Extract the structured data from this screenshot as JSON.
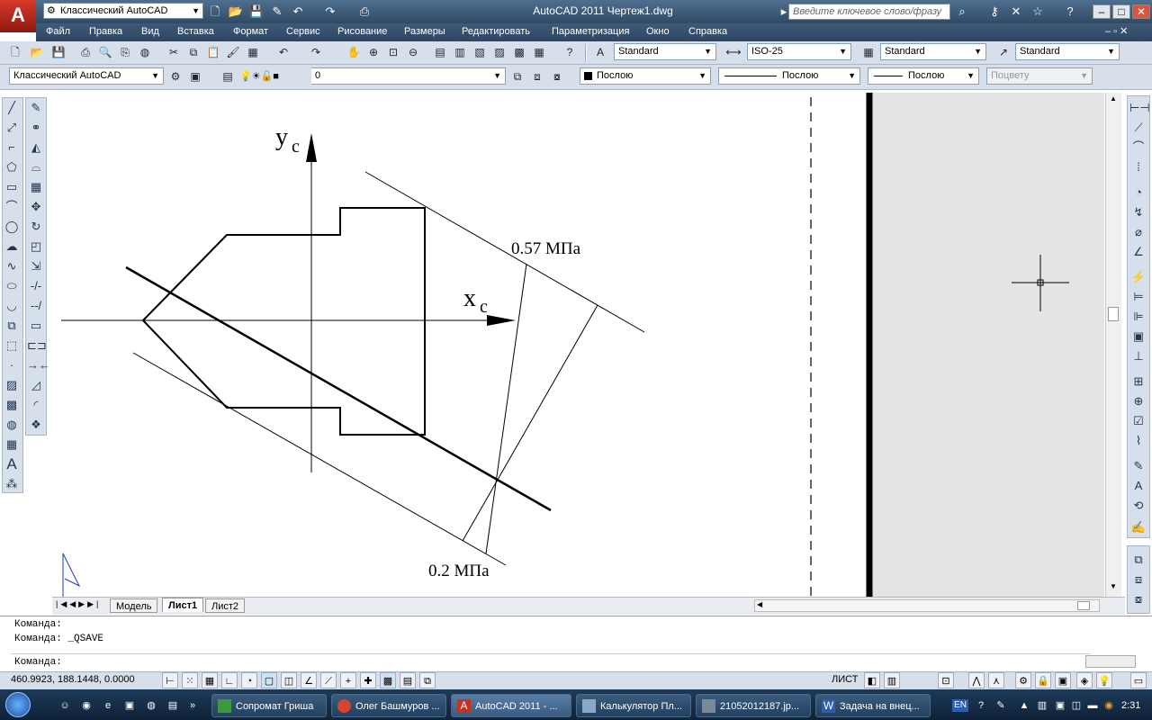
{
  "app": {
    "title": "AutoCAD 2011   Чертеж1.dwg",
    "logo_letter": "A",
    "workspace_title_combo": "Классический AutoCAD",
    "search_placeholder": "Введите ключевое слово/фразу",
    "help_symbol": "?"
  },
  "menu": [
    "Файл",
    "Правка",
    "Вид",
    "Вставка",
    "Формат",
    "Сервис",
    "Рисование",
    "Размеры",
    "Редактировать",
    "Параметризация",
    "Окно",
    "Справка"
  ],
  "styles_toolbar": {
    "text_style": "Standard",
    "dim_style": "ISO-25",
    "table_style": "Standard",
    "multileader_style": "Standard"
  },
  "layers_toolbar": {
    "workspace": "Классический AutoCAD",
    "layer": "0",
    "color": "Послою",
    "linetype": "Послою",
    "lineweight": "Послою",
    "plot_style": "Поцвету"
  },
  "drawing": {
    "axis_y_label": "y",
    "axis_y_sub": "c",
    "axis_x_label": "x",
    "axis_x_sub": "c",
    "stress_top": "0.57 МПа",
    "stress_bottom": "0.2 МПа"
  },
  "tabs": [
    "Модель",
    "Лист1",
    "Лист2"
  ],
  "command": {
    "line1": "Команда:",
    "line2": "Команда:  _QSAVE",
    "prompt": "Команда:"
  },
  "status": {
    "coords": "460.9923, 188.1448, 0.0000",
    "space": "ЛИСТ"
  },
  "taskbar": {
    "items": [
      {
        "label": "Сопромат Гриша"
      },
      {
        "label": "Олег Башмуров ..."
      },
      {
        "label": "AutoCAD 2011 - ..."
      },
      {
        "label": "Калькулятор Пл..."
      },
      {
        "label": "21052012187.jp..."
      },
      {
        "label": "Задача на внец..."
      }
    ],
    "language": "EN",
    "clock": "2:31"
  },
  "colors": {
    "title_bar": "#2f4a66",
    "toolbar_bg": "#d6dfea",
    "logo_red": "#c8301f",
    "taskbar": "#14293f"
  }
}
